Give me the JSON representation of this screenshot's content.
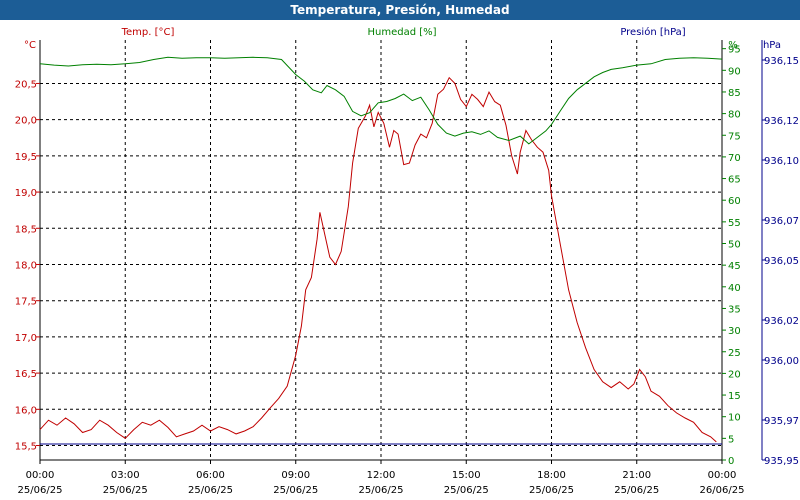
{
  "window": {
    "title": "Temperatura, Presión, Humedad"
  },
  "colors": {
    "temp": "#c00000",
    "hum": "#008000",
    "pres": "#00008b",
    "titlebar": "#1c5d96"
  },
  "chart_data": {
    "type": "line",
    "x_ticks": [
      {
        "time": "00:00",
        "date": "25/06/25"
      },
      {
        "time": "03:00",
        "date": "25/06/25"
      },
      {
        "time": "06:00",
        "date": "25/06/25"
      },
      {
        "time": "09:00",
        "date": "25/06/25"
      },
      {
        "time": "12:00",
        "date": "25/06/25"
      },
      {
        "time": "15:00",
        "date": "25/06/25"
      },
      {
        "time": "18:00",
        "date": "25/06/25"
      },
      {
        "time": "21:00",
        "date": "25/06/25"
      },
      {
        "time": "00:00",
        "date": "26/06/25"
      }
    ],
    "x_range_hours": [
      0,
      24
    ],
    "axes": {
      "temp": {
        "unit": "°C",
        "legend": "Temp. [°C]",
        "range": [
          15.3,
          21.1
        ],
        "ticks": [
          "20,5",
          "20,0",
          "19,5",
          "19,0",
          "18,5",
          "18,0",
          "17,5",
          "17,0",
          "16,5",
          "16,0",
          "15,5"
        ]
      },
      "hum": {
        "unit": "%",
        "legend": "Humedad [%]",
        "range": [
          0,
          97
        ],
        "ticks": [
          "95",
          "90",
          "85",
          "80",
          "75",
          "70",
          "65",
          "60",
          "55",
          "50",
          "45",
          "40",
          "35",
          "30",
          "25",
          "20",
          "15",
          "10",
          "5",
          "0"
        ]
      },
      "pres": {
        "unit": "hPa",
        "legend": "Presión [hPa]",
        "range": [
          935.95,
          936.16
        ],
        "ticks": [
          "936,15",
          "936,12",
          "936,10",
          "936,07",
          "936,05",
          "936,02",
          "936,00",
          "935,97",
          "935,95"
        ]
      }
    },
    "series": [
      {
        "name": "Temp. [°C]",
        "axis": "temp",
        "points": [
          [
            0.0,
            15.72
          ],
          [
            0.3,
            15.85
          ],
          [
            0.6,
            15.78
          ],
          [
            0.9,
            15.88
          ],
          [
            1.2,
            15.8
          ],
          [
            1.5,
            15.68
          ],
          [
            1.8,
            15.72
          ],
          [
            2.1,
            15.85
          ],
          [
            2.4,
            15.78
          ],
          [
            2.7,
            15.68
          ],
          [
            3.0,
            15.6
          ],
          [
            3.3,
            15.72
          ],
          [
            3.6,
            15.82
          ],
          [
            3.9,
            15.78
          ],
          [
            4.2,
            15.85
          ],
          [
            4.5,
            15.75
          ],
          [
            4.8,
            15.62
          ],
          [
            5.1,
            15.66
          ],
          [
            5.4,
            15.7
          ],
          [
            5.7,
            15.78
          ],
          [
            6.0,
            15.7
          ],
          [
            6.3,
            15.76
          ],
          [
            6.6,
            15.72
          ],
          [
            6.9,
            15.66
          ],
          [
            7.2,
            15.7
          ],
          [
            7.5,
            15.76
          ],
          [
            7.8,
            15.88
          ],
          [
            8.1,
            16.02
          ],
          [
            8.4,
            16.15
          ],
          [
            8.7,
            16.32
          ],
          [
            9.0,
            16.75
          ],
          [
            9.2,
            17.15
          ],
          [
            9.35,
            17.65
          ],
          [
            9.55,
            17.82
          ],
          [
            9.75,
            18.35
          ],
          [
            9.85,
            18.72
          ],
          [
            10.0,
            18.45
          ],
          [
            10.2,
            18.1
          ],
          [
            10.4,
            18.0
          ],
          [
            10.6,
            18.18
          ],
          [
            10.85,
            18.8
          ],
          [
            11.0,
            19.4
          ],
          [
            11.2,
            19.88
          ],
          [
            11.45,
            20.05
          ],
          [
            11.6,
            20.2
          ],
          [
            11.75,
            19.9
          ],
          [
            11.9,
            20.1
          ],
          [
            12.1,
            19.95
          ],
          [
            12.3,
            19.62
          ],
          [
            12.45,
            19.85
          ],
          [
            12.6,
            19.8
          ],
          [
            12.8,
            19.38
          ],
          [
            13.0,
            19.4
          ],
          [
            13.2,
            19.65
          ],
          [
            13.4,
            19.8
          ],
          [
            13.6,
            19.75
          ],
          [
            13.8,
            19.95
          ],
          [
            14.0,
            20.35
          ],
          [
            14.2,
            20.42
          ],
          [
            14.4,
            20.58
          ],
          [
            14.6,
            20.5
          ],
          [
            14.8,
            20.28
          ],
          [
            15.0,
            20.18
          ],
          [
            15.2,
            20.35
          ],
          [
            15.4,
            20.28
          ],
          [
            15.6,
            20.18
          ],
          [
            15.8,
            20.38
          ],
          [
            16.0,
            20.25
          ],
          [
            16.2,
            20.2
          ],
          [
            16.4,
            19.92
          ],
          [
            16.6,
            19.5
          ],
          [
            16.8,
            19.25
          ],
          [
            16.9,
            19.55
          ],
          [
            17.1,
            19.85
          ],
          [
            17.3,
            19.72
          ],
          [
            17.5,
            19.62
          ],
          [
            17.7,
            19.55
          ],
          [
            17.9,
            19.3
          ],
          [
            18.0,
            18.95
          ],
          [
            18.3,
            18.3
          ],
          [
            18.6,
            17.65
          ],
          [
            18.9,
            17.2
          ],
          [
            19.2,
            16.85
          ],
          [
            19.5,
            16.55
          ],
          [
            19.8,
            16.38
          ],
          [
            20.1,
            16.3
          ],
          [
            20.4,
            16.38
          ],
          [
            20.7,
            16.28
          ],
          [
            20.9,
            16.35
          ],
          [
            21.1,
            16.55
          ],
          [
            21.3,
            16.45
          ],
          [
            21.5,
            16.25
          ],
          [
            21.8,
            16.18
          ],
          [
            22.1,
            16.05
          ],
          [
            22.4,
            15.95
          ],
          [
            22.7,
            15.88
          ],
          [
            23.0,
            15.82
          ],
          [
            23.3,
            15.68
          ],
          [
            23.6,
            15.62
          ],
          [
            23.8,
            15.55
          ]
        ]
      },
      {
        "name": "Humedad [%]",
        "axis": "hum",
        "points": [
          [
            0.0,
            91.5
          ],
          [
            0.5,
            91.2
          ],
          [
            1.0,
            91.0
          ],
          [
            1.5,
            91.3
          ],
          [
            2.0,
            91.4
          ],
          [
            2.5,
            91.3
          ],
          [
            3.0,
            91.5
          ],
          [
            3.5,
            91.8
          ],
          [
            4.0,
            92.5
          ],
          [
            4.5,
            93.0
          ],
          [
            5.0,
            92.8
          ],
          [
            5.5,
            92.9
          ],
          [
            6.0,
            92.9
          ],
          [
            6.5,
            92.8
          ],
          [
            7.0,
            92.9
          ],
          [
            7.5,
            93.0
          ],
          [
            8.0,
            92.9
          ],
          [
            8.5,
            92.5
          ],
          [
            9.0,
            89.0
          ],
          [
            9.3,
            87.5
          ],
          [
            9.6,
            85.5
          ],
          [
            9.9,
            84.8
          ],
          [
            10.1,
            86.5
          ],
          [
            10.4,
            85.5
          ],
          [
            10.7,
            84.0
          ],
          [
            11.0,
            80.5
          ],
          [
            11.3,
            79.5
          ],
          [
            11.6,
            80.2
          ],
          [
            11.9,
            82.5
          ],
          [
            12.2,
            82.8
          ],
          [
            12.5,
            83.5
          ],
          [
            12.8,
            84.5
          ],
          [
            13.1,
            83.0
          ],
          [
            13.4,
            83.8
          ],
          [
            13.7,
            80.8
          ],
          [
            14.0,
            77.5
          ],
          [
            14.3,
            75.5
          ],
          [
            14.6,
            74.8
          ],
          [
            14.9,
            75.5
          ],
          [
            15.2,
            75.8
          ],
          [
            15.5,
            75.2
          ],
          [
            15.8,
            76.0
          ],
          [
            16.1,
            74.5
          ],
          [
            16.5,
            73.8
          ],
          [
            16.9,
            74.8
          ],
          [
            17.2,
            73.0
          ],
          [
            17.5,
            74.5
          ],
          [
            17.8,
            76.0
          ],
          [
            18.0,
            77.5
          ],
          [
            18.3,
            80.5
          ],
          [
            18.6,
            83.5
          ],
          [
            18.9,
            85.5
          ],
          [
            19.2,
            87.0
          ],
          [
            19.5,
            88.5
          ],
          [
            19.8,
            89.5
          ],
          [
            20.1,
            90.2
          ],
          [
            20.5,
            90.6
          ],
          [
            21.0,
            91.2
          ],
          [
            21.5,
            91.5
          ],
          [
            22.0,
            92.5
          ],
          [
            22.5,
            92.8
          ],
          [
            23.0,
            92.9
          ],
          [
            23.5,
            92.8
          ],
          [
            24.0,
            92.6
          ]
        ]
      },
      {
        "name": "Presión [hPa]",
        "axis": "pres",
        "points": [
          [
            0,
            935.958
          ],
          [
            24,
            935.958
          ]
        ]
      }
    ]
  }
}
